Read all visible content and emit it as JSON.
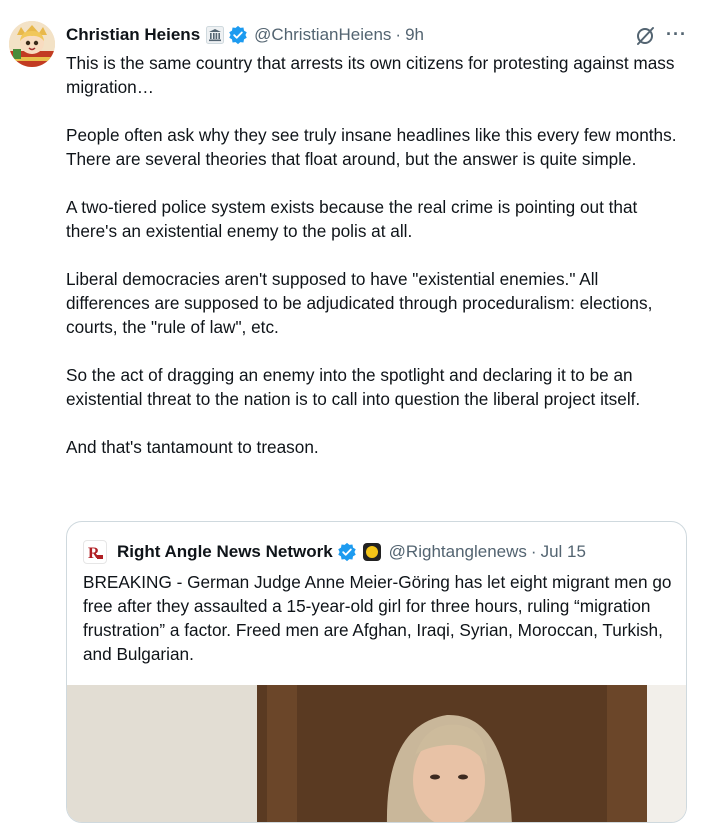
{
  "author": {
    "name": "Christian Heiens",
    "handle": "@ChristianHeiens",
    "time": "9h"
  },
  "tweet": {
    "paragraphs": [
      "This is the same country that arrests its own citizens for protesting against mass migration…",
      "People often ask why they see truly insane headlines like this every few months. There are several theories that float around, but the answer is quite simple.",
      "A two-tiered police system exists because the real crime is pointing out that there's an existential enemy to the polis at all.",
      "Liberal democracies aren't supposed to have \"existential enemies.\" All differences are supposed to be adjudicated through proceduralism: elections, courts, the \"rule of law\", etc.",
      "So the act of dragging an enemy into the spotlight and declaring it to be an existential threat to the nation is to call into question the liberal project itself.",
      "And that's tantamount to treason."
    ]
  },
  "quote": {
    "name": "Right Angle News Network",
    "handle": "@Rightanglenews",
    "time": "Jul 15",
    "text": "BREAKING - German Judge Anne Meier-Göring has let eight migrant men go free after they assaulted a 15-year-old girl for three hours, ruling “migration frustration” a factor. Freed men are Afghan, Iraqi, Syrian, Moroccan, Turkish, and Bulgarian."
  },
  "icons": {
    "affiliation": "government-building-icon",
    "verified": "verified-badge-icon",
    "grok": "grok-icon",
    "more": "more-icon"
  },
  "colors": {
    "verified": "#1d9bf0",
    "secondary_text": "#536471",
    "border": "#cfd9de"
  }
}
